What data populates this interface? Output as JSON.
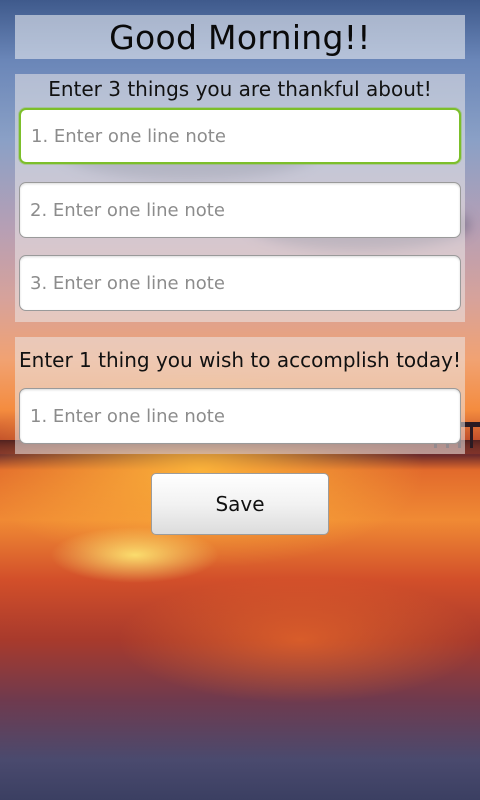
{
  "header": {
    "title": "Good Morning!!"
  },
  "thankful": {
    "heading": "Enter 3 things you are thankful about!",
    "inputs": [
      {
        "value": "",
        "placeholder": "1. Enter one line note"
      },
      {
        "value": "",
        "placeholder": "2. Enter one line note"
      },
      {
        "value": "",
        "placeholder": "3. Enter one line note"
      }
    ]
  },
  "accomplish": {
    "heading": "Enter 1 thing you wish to accomplish today!",
    "inputs": [
      {
        "value": "",
        "placeholder": "1. Enter one line note"
      }
    ]
  },
  "actions": {
    "save_label": "Save"
  },
  "colors": {
    "focus_border": "#7cbf2a"
  }
}
